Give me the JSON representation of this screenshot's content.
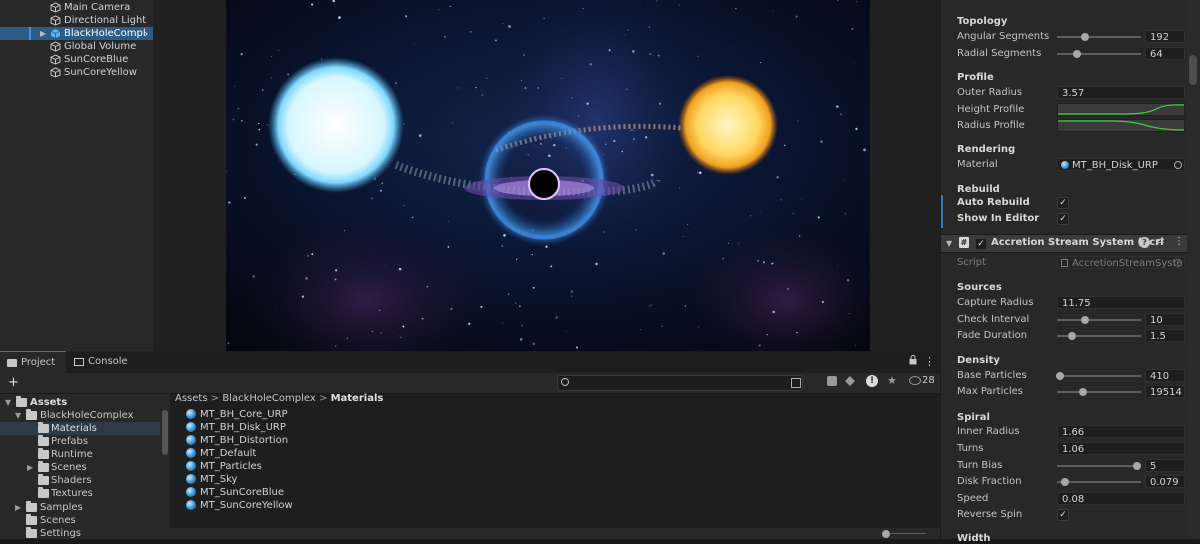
{
  "hierarchy": {
    "items": [
      {
        "label": "Main Camera",
        "icon": "cube-icon"
      },
      {
        "label": "Directional Light",
        "icon": "cube-icon"
      },
      {
        "label": "BlackHoleCompl",
        "icon": "prefab-cube-icon",
        "selected": true
      },
      {
        "label": "Global Volume",
        "icon": "cube-icon"
      },
      {
        "label": "SunCoreBlue",
        "icon": "cube-icon"
      },
      {
        "label": "SunCoreYellow",
        "icon": "cube-icon"
      }
    ],
    "expand_glyph": "▶",
    "more_glyph": "›"
  },
  "project": {
    "tabs": [
      {
        "label": "Project"
      },
      {
        "label": "Console"
      }
    ],
    "add_glyph": "+",
    "search_icon_glyph": "🔍",
    "count": "28",
    "tree": [
      {
        "label": "Assets",
        "bold": true,
        "expanded": true,
        "indent": 0
      },
      {
        "label": "BlackHoleComplex",
        "expanded": true,
        "indent": 1
      },
      {
        "label": "Materials",
        "indent": 2,
        "selected": true
      },
      {
        "label": "Prefabs",
        "indent": 2
      },
      {
        "label": "Runtime",
        "indent": 2
      },
      {
        "label": "Scenes",
        "indent": 2,
        "collapsed": true
      },
      {
        "label": "Shaders",
        "indent": 2
      },
      {
        "label": "Textures",
        "indent": 2
      },
      {
        "label": "Samples",
        "indent": 1,
        "collapsed": true
      },
      {
        "label": "Scenes",
        "indent": 1
      },
      {
        "label": "Settings",
        "indent": 1
      }
    ],
    "breadcrumb": {
      "part1": "Assets",
      "part2": "BlackHoleComplex",
      "part3": "Materials",
      "sep": ">"
    },
    "materials": [
      "MT_BH_Core_URP",
      "MT_BH_Disk_URP",
      "MT_BH_Distortion",
      "MT_Default",
      "MT_Particles",
      "MT_Sky",
      "MT_SunCoreBlue",
      "MT_SunCoreYellow"
    ]
  },
  "inspector": {
    "topology": {
      "header": "Topology",
      "angular_label": "Angular Segments",
      "angular_value": "192",
      "angular_fraction": 0.33,
      "radial_label": "Radial Segments",
      "radial_value": "64",
      "radial_fraction": 0.24
    },
    "profile": {
      "header": "Profile",
      "outer_radius_label": "Outer Radius",
      "outer_radius_value": "3.57",
      "height_profile_label": "Height Profile",
      "radius_profile_label": "Radius Profile"
    },
    "rendering": {
      "header": "Rendering",
      "material_label": "Material",
      "material_value": "MT_BH_Disk_URP"
    },
    "rebuild": {
      "header": "Rebuild",
      "auto_label": "Auto Rebuild",
      "auto_checked": true,
      "editor_label": "Show In Editor",
      "editor_checked": true
    },
    "component": {
      "title": "Accretion Stream System (Scri",
      "script_label": "Script",
      "script_value": "AccretionStreamSyste",
      "help_glyph": "?",
      "settings_glyph": "⇄",
      "menu_glyph": "⋮",
      "hash_glyph": "#",
      "check_glyph": "✓"
    },
    "sources": {
      "header": "Sources",
      "capture_label": "Capture Radius",
      "capture_value": "11.75",
      "check_label": "Check Interval",
      "check_value": "10",
      "check_fraction": 0.33,
      "fade_label": "Fade Duration",
      "fade_value": "1.5",
      "fade_fraction": 0.18
    },
    "density": {
      "header": "Density",
      "base_label": "Base Particles",
      "base_value": "410",
      "base_fraction": 0.04,
      "max_label": "Max Particles",
      "max_value": "19514",
      "max_fraction": 0.31
    },
    "spiral": {
      "header": "Spiral",
      "inner_label": "Inner Radius",
      "inner_value": "1.66",
      "turns_label": "Turns",
      "turns_value": "1.06",
      "bias_label": "Turn Bias",
      "bias_value": "5",
      "bias_fraction": 0.95,
      "disk_label": "Disk Fraction",
      "disk_value": "0.079",
      "disk_fraction": 0.1,
      "speed_label": "Speed",
      "speed_value": "0.08",
      "reverse_label": "Reverse Spin",
      "reverse_checked": true
    },
    "width_header": "Width"
  },
  "colors": {
    "selection": "#2c5d87",
    "accent": "#3a79bb",
    "curve": "#3fd13f"
  }
}
